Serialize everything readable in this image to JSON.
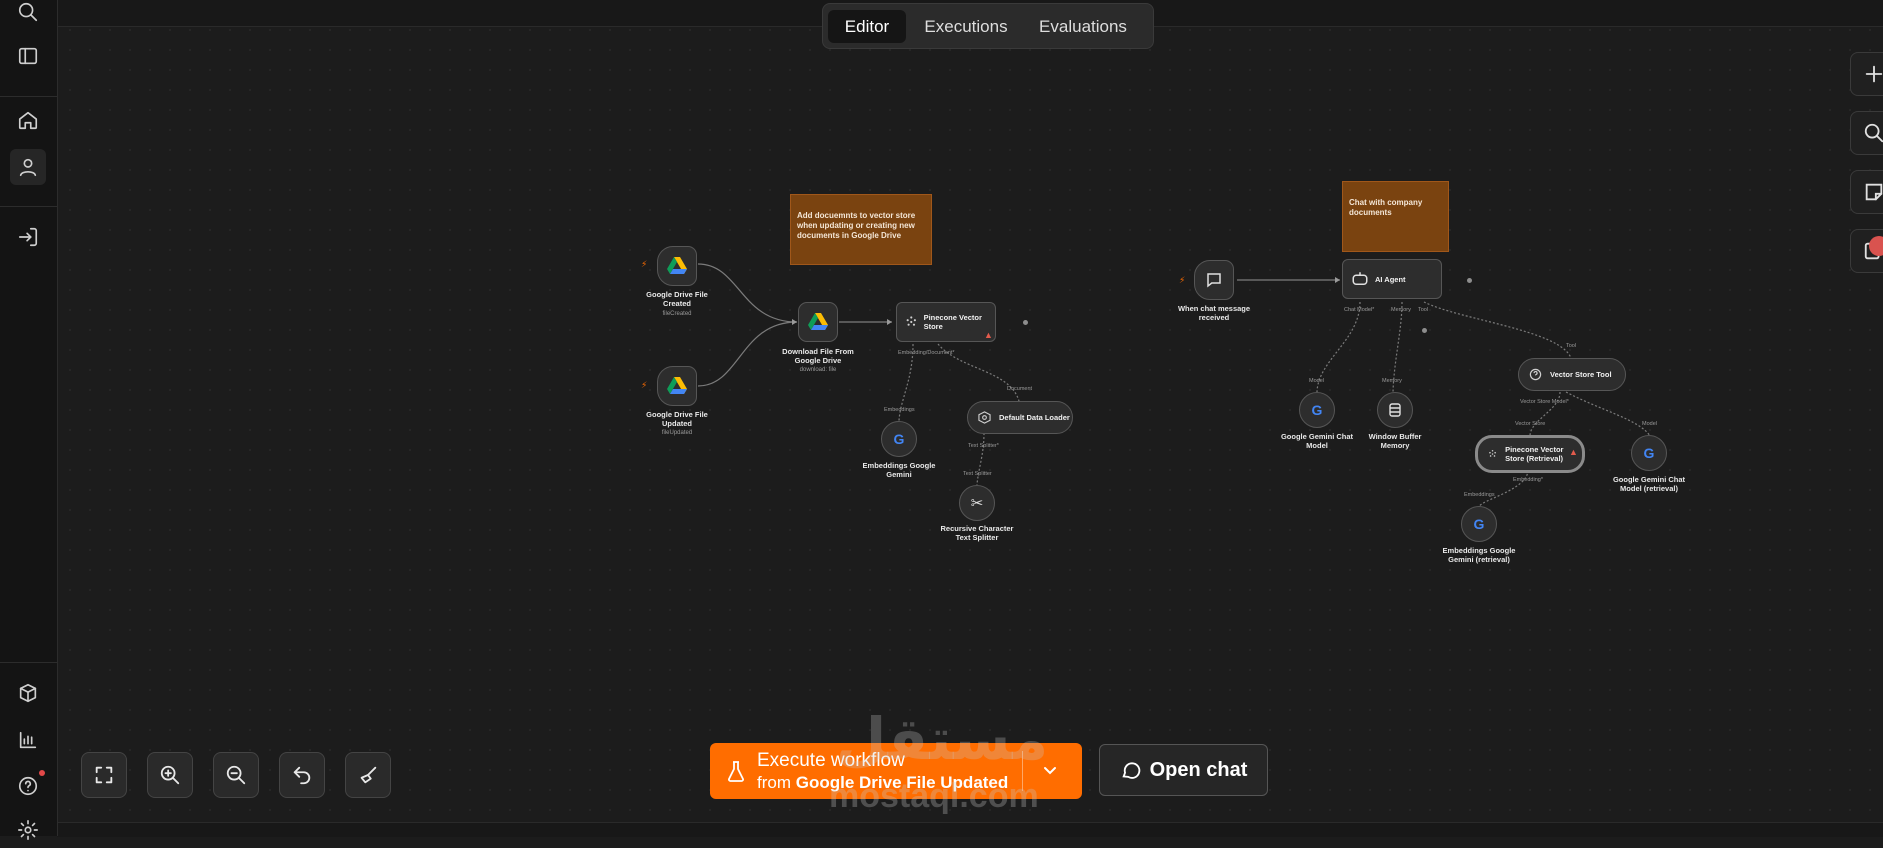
{
  "tabs": [
    {
      "label": "Editor",
      "active": true
    },
    {
      "label": "Executions",
      "active": false
    },
    {
      "label": "Evaluations",
      "active": false
    }
  ],
  "sidebar": {
    "icons": [
      "search-icon",
      "panel-toggle-icon",
      "home-icon",
      "user-icon",
      "sign-in-icon",
      "templates-icon",
      "insights-icon",
      "help-icon",
      "settings-icon"
    ]
  },
  "notes": [
    {
      "text": "Add docuemnts to vector store when updating or creating new documents in Google Drive"
    },
    {
      "text": "Chat with company documents"
    }
  ],
  "nodes": {
    "gdrive_created": {
      "title": "Google Drive File Created",
      "sub": "fileCreated"
    },
    "gdrive_updated": {
      "title": "Google Drive File Updated",
      "sub": "fileUpdated"
    },
    "download": {
      "title": "Download File From Google Drive",
      "sub": "download: file"
    },
    "pinecone": {
      "title": "Pinecone Vector Store"
    },
    "embeddings": {
      "title": "Embeddings Google Gemini"
    },
    "loader": {
      "title": "Default Data Loader"
    },
    "splitter": {
      "title": "Recursive Character Text Splitter"
    },
    "chat_trigger": {
      "title": "When chat message received"
    },
    "agent": {
      "title": "AI Agent"
    },
    "gemini_chat": {
      "title": "Google Gemini Chat Model"
    },
    "memory": {
      "title": "Window Buffer Memory"
    },
    "vs_tool": {
      "title": "Vector Store Tool"
    },
    "pinecone_ret": {
      "title": "Pinecone Vector Store (Retrieval)"
    },
    "gemini_ret": {
      "title": "Google Gemini Chat Model (retrieval)"
    },
    "embed_ret": {
      "title": "Embeddings Google Gemini (retrieval)"
    }
  },
  "ports": {
    "embedding_doc": "Embedding/Document*",
    "embeddings": "Embeddings",
    "document": "Document",
    "text_splitter_out": "Text Splitter*",
    "text_splitter_in": "Text Splitter",
    "chat_model": "Chat Model*",
    "memory": "Memory",
    "tool": "Tool",
    "model": "Model",
    "memory_in": "Memory",
    "tool_in": "Tool",
    "vector_store_model": "Vector Store Model*",
    "vector_store": "Vector Store",
    "model_in": "Model",
    "embedding": "Embedding*",
    "embeddings_in": "Embeddings"
  },
  "execute": {
    "line1": "Execute workflow",
    "prefix": "from",
    "source": "Google Drive File Updated"
  },
  "open_chat": "Open chat",
  "watermark": {
    "line1": "مستقل",
    "line2": "mostaql.com"
  }
}
